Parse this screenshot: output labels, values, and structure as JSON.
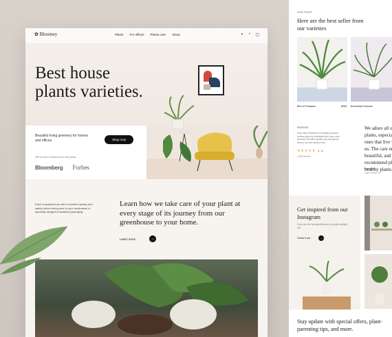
{
  "main": {
    "logo": "Bloomey",
    "nav_links": [
      "Plants",
      "For offices",
      "Plants care",
      "About"
    ],
    "hero_title_line1": "Best house",
    "hero_title_line2": "plants varieties.",
    "tagline": "Beautiful living greenery for homes and offices",
    "shop_button": "Shop now",
    "mention_text": "We've been mentioned in the press",
    "brands": [
      "Bloomberg",
      "Forbes"
    ],
    "story_small": "Each houseplant we sell is handled quickly and safely before being sent to your destination in specially designed insulated packaging.",
    "story_title": "Learn how we take care of your plant at every stage of its journey from our greenhouse to your home.",
    "learn_more": "Learn more"
  },
  "side": {
    "eyebrow": "OUR SHOP",
    "bestseller_title": "Here are the best seller from our varieties",
    "product1_name": "Bird of Paradise",
    "product1_price": "$280",
    "product2_name": "Bromeliad Summer",
    "reviews_label": "REVIEWS",
    "reviews_text": "Shop with confidence by reading customer reviews given by individuals who have used Bloomey. Excellent quality and exceptional service are both offered here.",
    "rating_value": "4.6",
    "ratings_count": "1,408 reviews",
    "quote": "We adore all our plants, especially the ones that live with us. The care needed, beautiful, and Highly recommend place for healthy plants.",
    "author_name": "Pamela S.",
    "author_location": "Lake Forest, CA",
    "insta_title": "Get inspired from our Instagram",
    "insta_text": "If you use the hashtag #bloomey, we might spotlight you.",
    "insta_cta": "Check it out",
    "newsletter": "Stay update with special offers, plant-parenting tips, and more."
  },
  "colors": {
    "accent": "#111111",
    "chair": "#e7c24b",
    "leaf": "#5f8f4e",
    "star": "#e9a640"
  }
}
